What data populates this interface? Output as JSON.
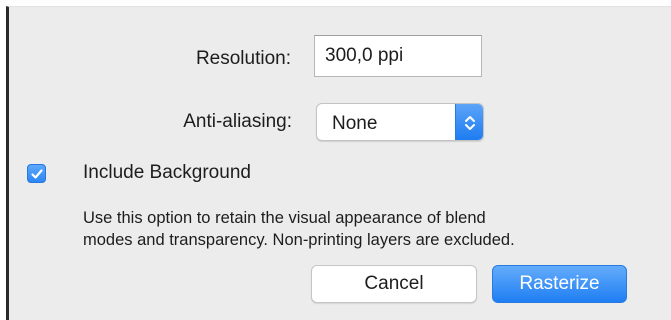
{
  "form": {
    "resolution_label": "Resolution:",
    "resolution_value": "300,0 ppi",
    "antialiasing_label": "Anti-aliasing:",
    "antialiasing_selected": "None"
  },
  "include_background": {
    "checked": true,
    "label": "Include Background"
  },
  "help_text": {
    "line1": "Use this option to retain the visual appearance of blend",
    "line2": "modes and transparency. Non-printing layers are excluded."
  },
  "buttons": {
    "cancel": "Cancel",
    "primary": "Rasterize"
  },
  "colors": {
    "accent": "#2c86f5",
    "dialog_background": "#ececec"
  },
  "icons": {
    "popup": "updown-chevron-icon",
    "checkbox": "checkmark-icon"
  }
}
